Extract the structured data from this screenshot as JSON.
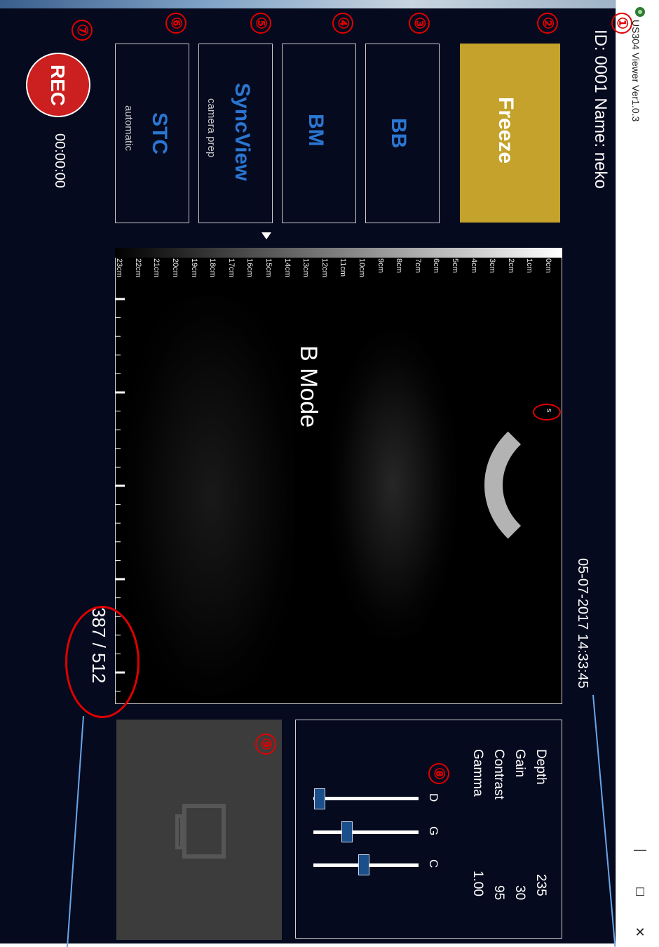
{
  "window": {
    "title": "US304 Viewer Ver1.0.3",
    "minimize": "—",
    "maximize": "☐",
    "close": "✕"
  },
  "header": {
    "patient": "ID: 0001  Name: neko",
    "datetime": "05-07-2017 14:33:45"
  },
  "controls": {
    "freeze": "Freeze",
    "bb": "BB",
    "bm": "BM",
    "syncview": "SyncView",
    "syncview_sub": "camera prep",
    "stc": "STC",
    "stc_sub": "automatic",
    "rec": "REC",
    "rec_time": "00:00:00"
  },
  "markers": [
    "①",
    "②",
    "③",
    "④",
    "⑤",
    "⑥",
    "⑦",
    "⑧",
    "⑨"
  ],
  "image": {
    "mode": "B Mode",
    "frame_counter": "387 / 512",
    "probe_marker": "s",
    "depth_ticks": [
      "0cm",
      "1cm",
      "2cm",
      "3cm",
      "4cm",
      "5cm",
      "6cm",
      "7cm",
      "8cm",
      "9cm",
      "10cm",
      "11cm",
      "12cm",
      "13cm",
      "14cm",
      "15cm",
      "16cm",
      "17cm",
      "18cm",
      "19cm",
      "20cm",
      "21cm",
      "22cm",
      "23cm"
    ]
  },
  "settings": {
    "depth_label": "Depth",
    "depth_value": "235",
    "gain_label": "Gain",
    "gain_value": "30",
    "contrast_label": "Contrast",
    "contrast_value": "95",
    "gamma_label": "Gamma",
    "gamma_value": "1.00",
    "slider_d": "D",
    "slider_g": "G",
    "slider_c": "C"
  },
  "colors": {
    "panel": "#050a1e",
    "freeze": "#c4a22b",
    "rec": "#cc1f1f",
    "label_blue": "#2a76d2",
    "marker_red": "#e00000"
  }
}
